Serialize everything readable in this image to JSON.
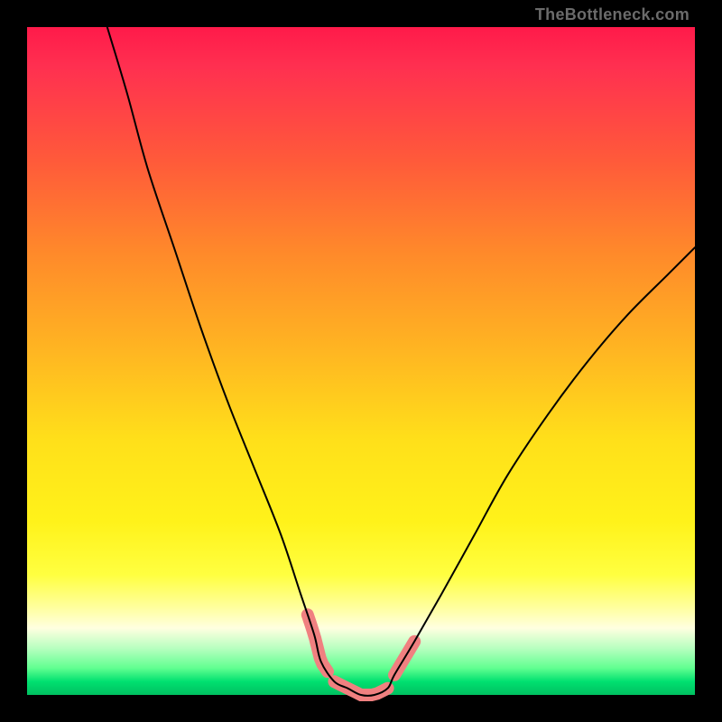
{
  "attribution": "TheBottleneck.com",
  "chart_data": {
    "type": "line",
    "title": "",
    "xlabel": "",
    "ylabel": "",
    "xlim": [
      0,
      100
    ],
    "ylim": [
      0,
      100
    ],
    "grid": false,
    "legend": false,
    "series": [
      {
        "name": "bottleneck-curve",
        "x": [
          12,
          15,
          18,
          22,
          26,
          30,
          34,
          38,
          41,
          43,
          44,
          46,
          48,
          50,
          52,
          54,
          55,
          58,
          62,
          67,
          72,
          78,
          84,
          90,
          96,
          100
        ],
        "values": [
          100,
          90,
          79,
          67,
          55,
          44,
          34,
          24,
          15,
          9,
          5,
          2,
          1,
          0,
          0,
          1,
          3,
          8,
          15,
          24,
          33,
          42,
          50,
          57,
          63,
          67
        ]
      }
    ],
    "annotations": [
      {
        "type": "highlight-segment",
        "x_range": [
          42,
          45
        ],
        "color": "#f08080"
      },
      {
        "type": "highlight-segment",
        "x_range": [
          46,
          54
        ],
        "color": "#f08080"
      },
      {
        "type": "highlight-segment",
        "x_range": [
          55,
          58
        ],
        "color": "#f08080"
      }
    ]
  },
  "colors": {
    "gradient_top": "#ff1a4a",
    "gradient_bottom": "#00c060",
    "highlight": "#f08080",
    "curve": "#000000",
    "frame": "#000000"
  }
}
